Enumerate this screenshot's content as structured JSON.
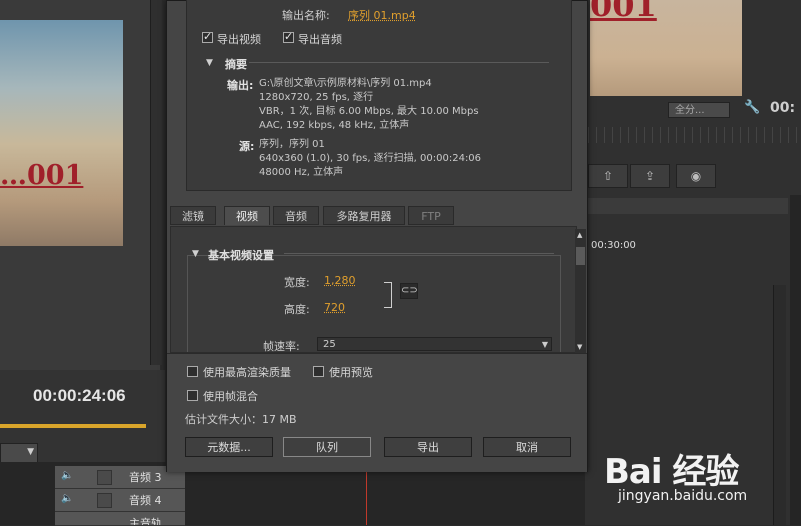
{
  "app": {
    "timecode_left": "00:00:24:06",
    "timecode_right": "00:",
    "seq_time": "00:30:00",
    "fit_select": "全分...",
    "thumb_left_text": "…001",
    "thumb_right_text": "001",
    "tracks": [
      {
        "label": "音频 3"
      },
      {
        "label": "音频 4"
      },
      {
        "label": "主音轨"
      }
    ]
  },
  "dialog": {
    "output_name_label": "输出名称:",
    "output_name_value": "序列 01.mp4",
    "export_video_label": "导出视频",
    "export_video_checked": true,
    "export_audio_label": "导出音频",
    "export_audio_checked": true,
    "summary": {
      "heading": "摘要",
      "output_key": "输出:",
      "output_lines": [
        "G:\\原创文章\\示例原材料\\序列 01.mp4",
        "1280x720, 25 fps, 逐行",
        "VBR，1 次, 目标 6.00 Mbps, 最大 10.00 Mbps",
        "AAC, 192 kbps, 48 kHz, 立体声"
      ],
      "source_key": "源:",
      "source_lines": [
        "序列，序列 01",
        "640x360 (1.0), 30 fps, 逐行扫描, 00:00:24:06",
        "48000 Hz, 立体声"
      ]
    },
    "tabs": [
      {
        "label": "滤镜",
        "active": false,
        "disabled": false
      },
      {
        "label": "视频",
        "active": true,
        "disabled": false
      },
      {
        "label": "音频",
        "active": false,
        "disabled": false
      },
      {
        "label": "多路复用器",
        "active": false,
        "disabled": false
      },
      {
        "label": "FTP",
        "active": false,
        "disabled": true
      }
    ],
    "basic_video": {
      "title": "基本视频设置",
      "width_label": "宽度:",
      "width_value": "1,280",
      "height_label": "高度:",
      "height_value": "720",
      "framerate_label": "帧速率:",
      "framerate_value": "25"
    },
    "options": {
      "max_render_label": "使用最高渲染质量",
      "max_render_checked": false,
      "previews_label": "使用预览",
      "previews_checked": false,
      "frame_blend_label": "使用帧混合",
      "frame_blend_checked": false
    },
    "file_size": "估计文件大小：17 MB",
    "buttons": {
      "metadata": "元数据...",
      "queue": "队列",
      "export": "导出",
      "cancel": "取消"
    }
  },
  "watermark": {
    "brand": "Bai 经验",
    "url": "jingyan.baidu.com"
  },
  "colors": {
    "accent_value": "#e09f2d",
    "progress_bar": "#d9a52b",
    "playhead": "#c0392b"
  }
}
